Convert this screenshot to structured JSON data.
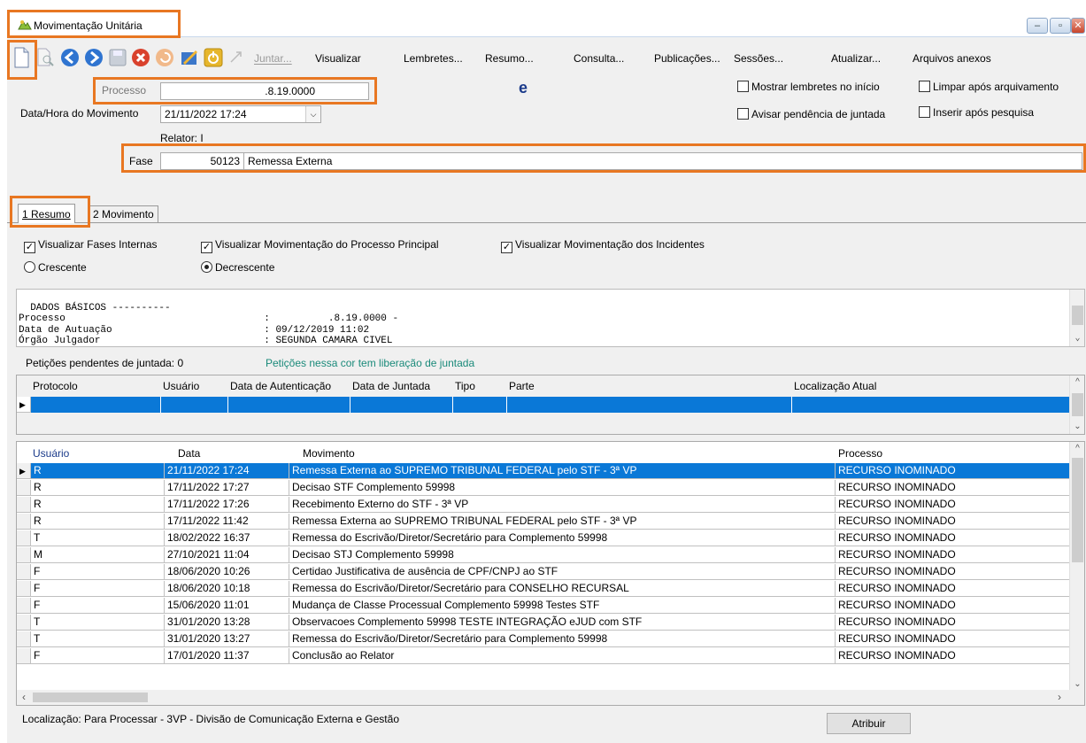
{
  "window": {
    "title": "Movimentação Unitária",
    "controls": [
      "–",
      "▫",
      "✕"
    ]
  },
  "toolbar": {
    "icons": [
      "new-document-icon",
      "search-document-icon",
      "back-arrow-icon",
      "forward-arrow-icon",
      "save-disk-icon",
      "cancel-icon",
      "undo-icon",
      "notes-icon",
      "power-icon",
      "link-icon"
    ],
    "menu": [
      {
        "label": "Juntar...",
        "disabled": true
      },
      {
        "label": "Visualizar",
        "disabled": false
      },
      {
        "label": "Lembretes...",
        "disabled": false
      },
      {
        "label": "Resumo...",
        "disabled": false
      },
      {
        "label": "Consulta...",
        "disabled": false
      },
      {
        "label": "Publicações...",
        "disabled": false
      },
      {
        "label": "Sessões...",
        "disabled": false
      },
      {
        "label": "Atualizar...",
        "disabled": false
      },
      {
        "label": "Arquivos anexos",
        "disabled": false
      }
    ]
  },
  "form": {
    "processo_label": "Processo",
    "processo_value": ".8.19.0000",
    "datahora_label": "Data/Hora do Movimento",
    "datahora_value": "21/11/2022 17:24",
    "relator_label": "Relator: I",
    "fase_label": "Fase",
    "fase_code": "50123",
    "fase_desc": "Remessa Externa",
    "ie_glyph": "e"
  },
  "options": {
    "mostrar_lembretes": "Mostrar lembretes no início",
    "limpar_apos": "Limpar após arquivamento",
    "avisar_pendencia": "Avisar pendência de juntada",
    "inserir_apos": "Inserir após pesquisa"
  },
  "tabs": [
    "1 Resumo",
    "2 Movimento"
  ],
  "filters": {
    "fases_internas": "Visualizar Fases Internas",
    "mov_principal": "Visualizar Movimentação do Processo Principal",
    "mov_incidentes": "Visualizar Movimentação dos Incidentes",
    "crescente": "Crescente",
    "decrescente": "Decrescente"
  },
  "memo": "DADOS BÁSICOS ----------\nProcesso                                  :          .8.19.0000 -\nData de Autuação                          : 09/12/2019 11:02\nÓrgão Julgador                            : SEGUNDA CAMARA CIVEL",
  "peticoes": {
    "pendentes_label": "Petições pendentes de juntada: 0",
    "legend": "Petições nessa cor tem liberação de juntada",
    "legend_color": "#1a8a7a",
    "columns": [
      "Protocolo",
      "Usuário",
      "Data de Autenticação",
      "Data de Juntada",
      "Tipo",
      "Parte",
      "Localização Atual"
    ]
  },
  "movimentos": {
    "columns": [
      "Usuário",
      "Data",
      "Movimento",
      "Processo"
    ],
    "rows": [
      [
        "R",
        "21/11/2022 17:24",
        "Remessa Externa ao SUPREMO TRIBUNAL FEDERAL pelo STF - 3ª VP",
        "RECURSO INOMINADO"
      ],
      [
        "R",
        "17/11/2022 17:27",
        "Decisao STF  Complemento 59998",
        "RECURSO INOMINADO"
      ],
      [
        "R",
        "17/11/2022 17:26",
        "Recebimento Externo do STF - 3ª VP",
        "RECURSO INOMINADO"
      ],
      [
        "R",
        "17/11/2022 11:42",
        "Remessa Externa ao SUPREMO TRIBUNAL FEDERAL pelo STF - 3ª VP",
        "RECURSO INOMINADO"
      ],
      [
        "T",
        "18/02/2022 16:37",
        "Remessa do Escrivão/Diretor/Secretário para Complemento 59998",
        "RECURSO INOMINADO"
      ],
      [
        "M",
        "27/10/2021 11:04",
        "Decisao STJ  Complemento 59998",
        "RECURSO INOMINADO"
      ],
      [
        "F",
        "18/06/2020 10:26",
        "Certidao  Justificativa de ausência de CPF/CNPJ ao STF",
        "RECURSO INOMINADO"
      ],
      [
        "F",
        "18/06/2020 10:18",
        "Remessa do Escrivão/Diretor/Secretário para CONSELHO RECURSAL",
        "RECURSO INOMINADO"
      ],
      [
        "F",
        "15/06/2020 11:01",
        "Mudança de Classe Processual  Complemento 59998 Testes STF",
        "RECURSO INOMINADO"
      ],
      [
        "T",
        "31/01/2020 13:28",
        "Observacoes  Complemento 59998 TESTE INTEGRAÇÃO eJUD com STF",
        "RECURSO INOMINADO"
      ],
      [
        "T",
        "31/01/2020 13:27",
        "Remessa do Escrivão/Diretor/Secretário para Complemento 59998",
        "RECURSO INOMINADO"
      ],
      [
        "F",
        "17/01/2020 11:37",
        "Conclusão ao Relator",
        "RECURSO INOMINADO"
      ]
    ]
  },
  "footer": {
    "localizacao": "Localização: Para Processar - 3VP - Divisão de Comunicação Externa e Gestão",
    "atribuir": "Atribuir"
  },
  "colors": {
    "selection": "#0a78d7",
    "highlight": "#e87722",
    "header_blue": "#1a3a8a"
  }
}
